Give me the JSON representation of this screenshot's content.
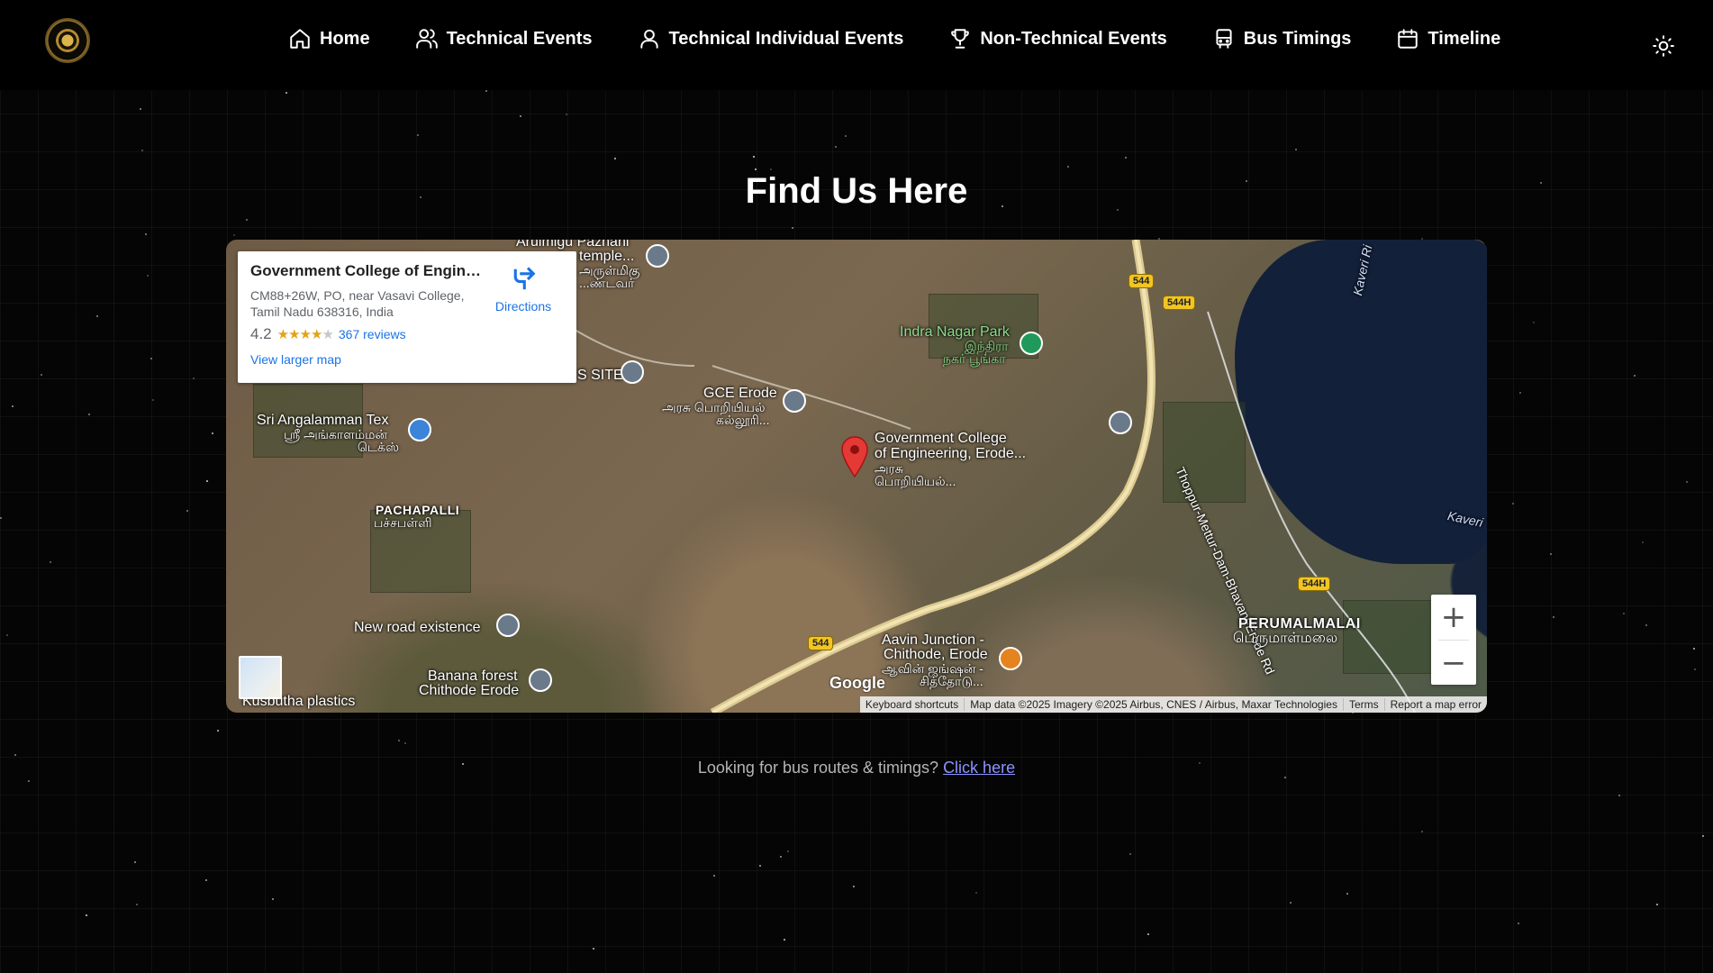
{
  "nav": {
    "items": [
      {
        "label": "Home",
        "icon": "home-icon"
      },
      {
        "label": "Technical Events",
        "icon": "users-icon"
      },
      {
        "label": "Technical Individual Events",
        "icon": "user-icon"
      },
      {
        "label": "Non-Technical Events",
        "icon": "trophy-icon"
      },
      {
        "label": "Bus Timings",
        "icon": "bus-icon"
      },
      {
        "label": "Timeline",
        "icon": "calendar-icon"
      }
    ],
    "theme_toggle_icon": "sun-icon",
    "logo_icon": "college-logo-icon"
  },
  "main": {
    "title": "Find Us Here"
  },
  "map": {
    "card": {
      "title": "Government College of Engine...",
      "address_line1": "CM88+26W, PO, near Vasavi College,",
      "address_line2": "Tamil Nadu 638316, India",
      "rating": "4.2",
      "rating_fraction": 0.84,
      "reviews": "367 reviews",
      "directions": "Directions",
      "view_larger": "View larger map"
    },
    "labels": {
      "temple": "Arulmigu Pazhani",
      "temple2": "temple...",
      "temple_ta": "அருள்மிகு",
      "temple_ta2": "...ண்டவர்",
      "site": "S SITE",
      "gce": "GCE Erode",
      "gce_ta": "அரசு பொறியியல்",
      "gce_ta2": "கல்லூரி...",
      "park": "Indra Nagar Park",
      "park_ta": "இந்திரா",
      "park_ta2": "நகர் பூங்கா",
      "sri": "Sri Angalamman Tex",
      "sri_ta": "ஸ்ரீ அங்காளம்மன்",
      "sri_ta2": "டெக்ஸ்",
      "college": "Government College",
      "college2": "of Engineering, Erode...",
      "college_ta": "அரசு",
      "college_ta2": "பொறியியல்...",
      "pachapalli": "PACHAPALLI",
      "pachapalli_ta": "பச்சபள்ளி",
      "road": "Thoppur-Mettur-Dam-Bhavani-Erode Rd",
      "newroad": "New road existence",
      "banana": "Banana forest",
      "banana2": "Chithode Erode",
      "aavin": "Aavin Junction -",
      "aavin2": "Chithode, Erode",
      "aavin_ta": "ஆவின் ஜங்ஷன் -",
      "aavin_ta2": "சித்தோடு...",
      "perumalmalai": "PERUMALMALAI",
      "perumalmalai_ta": "பெருமாள்மலை",
      "kusbutha": "Kusbutha plastics",
      "kaveri": "Kaveri Ri",
      "kaveri2": "Kaveri",
      "s544a": "544",
      "s544h": "544H",
      "s544h2": "544H",
      "s544b": "544"
    },
    "google": "Google",
    "attribution": {
      "shortcuts": "Keyboard shortcuts",
      "data": "Map data ©2025 Imagery ©2025 Airbus, CNES / Airbus, Maxar Technologies",
      "terms": "Terms",
      "report": "Report a map error"
    },
    "zoom_in": "+",
    "zoom_out": "−"
  },
  "bus_note": {
    "text": "Looking for bus routes & timings?",
    "link": "Click here"
  }
}
